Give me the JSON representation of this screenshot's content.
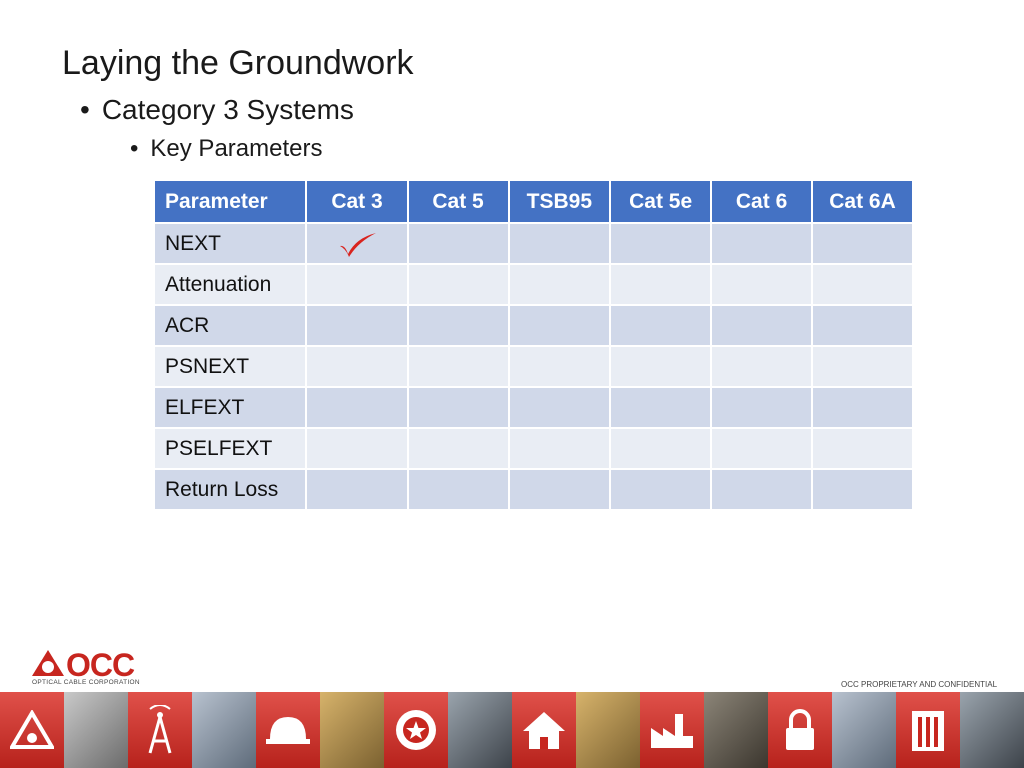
{
  "slide": {
    "title": "Laying the Groundwork",
    "bullet1": "Category 3 Systems",
    "bullet2": "Key Parameters"
  },
  "table": {
    "headers": [
      "Parameter",
      "Cat 3",
      "Cat 5",
      "TSB95",
      "Cat 5e",
      "Cat 6",
      "Cat 6A"
    ],
    "rows": [
      {
        "label": "NEXT",
        "checks": [
          true,
          false,
          false,
          false,
          false,
          false
        ]
      },
      {
        "label": "Attenuation",
        "checks": [
          false,
          false,
          false,
          false,
          false,
          false
        ]
      },
      {
        "label": "ACR",
        "checks": [
          false,
          false,
          false,
          false,
          false,
          false
        ]
      },
      {
        "label": "PSNEXT",
        "checks": [
          false,
          false,
          false,
          false,
          false,
          false
        ]
      },
      {
        "label": "ELFEXT",
        "checks": [
          false,
          false,
          false,
          false,
          false,
          false
        ]
      },
      {
        "label": "PSELFEXT",
        "checks": [
          false,
          false,
          false,
          false,
          false,
          false
        ]
      },
      {
        "label": "Return Loss",
        "checks": [
          false,
          false,
          false,
          false,
          false,
          false
        ]
      }
    ],
    "check_color": "#d9241f"
  },
  "footer": {
    "logo_text": "OCC",
    "logo_subtitle": "OPTICAL CABLE CORPORATION",
    "confidential": "OCC PROPRIETARY AND CONFIDENTIAL"
  },
  "colors": {
    "header_bg": "#4472c4",
    "row_odd": "#d0d8e9",
    "row_even": "#e9edf4",
    "brand_red": "#c7261f"
  },
  "strip_icons": [
    "warning-icon",
    "antenna-tower-icon",
    "hard-hat-icon",
    "military-badge-icon",
    "home-icon",
    "factory-icon",
    "lock-icon",
    "building-icon"
  ]
}
